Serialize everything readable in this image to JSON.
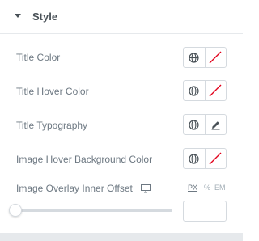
{
  "section": {
    "title": "Style",
    "expanded": true
  },
  "rows": {
    "title_color": {
      "label": "Title Color"
    },
    "title_hover_color": {
      "label": "Title Hover Color"
    },
    "title_typography": {
      "label": "Title Typography"
    },
    "image_hover_bg_color": {
      "label": "Image Hover Background Color"
    }
  },
  "offset": {
    "label": "Image Overlay Inner Offset",
    "units": {
      "px": "PX",
      "percent": "%",
      "em": "EM"
    },
    "selected_unit": "PX",
    "value": "",
    "slider_value": 0
  },
  "icons": {
    "caret": "caret-down-icon",
    "globe": "globe-icon",
    "pencil": "pencil-icon",
    "no_color": "no-color-swatch",
    "monitor": "monitor-icon"
  },
  "colors": {
    "no_color_slash": "#e2001a",
    "text": "#6d7882",
    "heading": "#495157",
    "border": "#d5dadf"
  }
}
